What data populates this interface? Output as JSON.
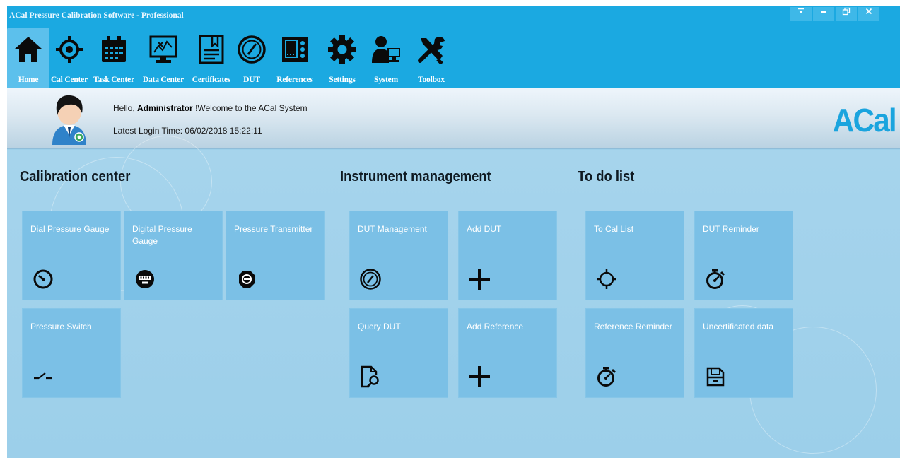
{
  "window": {
    "title": "ACal Pressure Calibration Software - Professional",
    "controls": {
      "menu": "▾",
      "minimize": "–",
      "restore": "🗗",
      "close": "✕"
    }
  },
  "nav": {
    "items": [
      {
        "label": "Home",
        "icon": "home-icon",
        "active": true
      },
      {
        "label": "Cal Center",
        "icon": "crosshair-icon"
      },
      {
        "label": "Task Center",
        "icon": "calendar-icon"
      },
      {
        "label": "Data Center",
        "icon": "chart-monitor-icon"
      },
      {
        "label": "Certificates",
        "icon": "certificate-icon"
      },
      {
        "label": "DUT",
        "icon": "gauge-icon"
      },
      {
        "label": "References",
        "icon": "reference-device-icon"
      },
      {
        "label": "Settings",
        "icon": "gear-icon"
      },
      {
        "label": "System",
        "icon": "user-computer-icon"
      },
      {
        "label": "Toolbox",
        "icon": "tools-icon"
      }
    ]
  },
  "welcome": {
    "hello": "Hello,",
    "user": "Administrator",
    "message": "!Welcome to the ACal System",
    "login_label": "Latest Login Time:",
    "login_time": "06/02/2018 15:22:11",
    "brand": "ACal"
  },
  "sections": {
    "calibration": {
      "title": "Calibration center",
      "tiles": [
        {
          "label": "Dial Pressure Gauge",
          "icon": "dial-gauge-icon"
        },
        {
          "label": "Digital Pressure Gauge",
          "icon": "digital-gauge-icon"
        },
        {
          "label": "Pressure Transmitter",
          "icon": "transmitter-icon"
        },
        {
          "label": "Pressure Switch",
          "icon": "switch-icon"
        }
      ]
    },
    "instrument": {
      "title": "Instrument management",
      "tiles": [
        {
          "label": "DUT Management",
          "icon": "gauge-icon"
        },
        {
          "label": "Add DUT",
          "icon": "plus-icon"
        },
        {
          "label": "Query DUT",
          "icon": "document-search-icon"
        },
        {
          "label": "Add Reference",
          "icon": "plus-icon"
        }
      ]
    },
    "todo": {
      "title": "To do list",
      "tiles": [
        {
          "label": "To Cal List",
          "icon": "crosshair-icon"
        },
        {
          "label": "DUT Reminder",
          "icon": "stopwatch-icon"
        },
        {
          "label": "Reference Reminder",
          "icon": "stopwatch-icon"
        },
        {
          "label": "Uncertificated data",
          "icon": "archive-box-icon"
        }
      ]
    }
  }
}
